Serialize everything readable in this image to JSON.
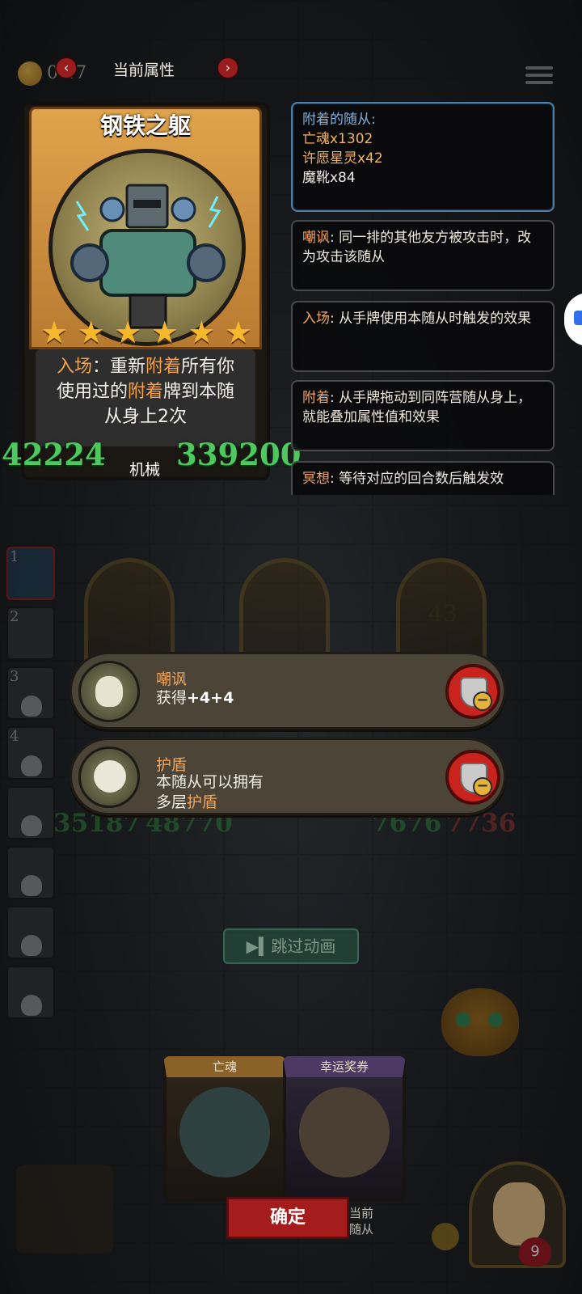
{
  "top_bar": {
    "coin_count": "0 17",
    "title": "当前属性",
    "prev_icon": "chevron-left-icon",
    "next_icon": "chevron-right-icon"
  },
  "hero_card": {
    "name": "钢铁之躯",
    "stars": 6,
    "desc_prefix": "入场",
    "desc_line1_a": "：重新",
    "desc_kw1": "附着",
    "desc_line1_b": "所有你",
    "desc_line2_a": "使用过的",
    "desc_kw2": "附着",
    "desc_line2_b": "牌到本随",
    "desc_line3": "从身上2次",
    "attack": "42224",
    "type": "机械",
    "health": "339200"
  },
  "info_panels": {
    "attached": {
      "title": "附着的随从:",
      "lines": [
        "亡魂x1302",
        "许愿星灵x42",
        "魔靴x84"
      ]
    },
    "taunt": {
      "keyword": "嘲讽",
      "text": ": 同一排的其他友方被攻击时，改为攻击该随从"
    },
    "entry": {
      "keyword": "入场",
      "text": ": 从手牌使用本随从时触发的效果"
    },
    "attach": {
      "keyword": "附着",
      "text": ": 从手牌拖动到同阵营随从身上，就能叠加属性值和效果"
    },
    "meditate": {
      "keyword": "冥想",
      "text": ": 等待对应的回合数后触发效"
    }
  },
  "board": {
    "hand_slots": [
      "1",
      "2",
      "3",
      "4",
      "",
      "",
      "",
      ""
    ],
    "ally_badge": "43",
    "left_stat": "35187",
    "left_stat_2": "48770",
    "right_stat": "7676",
    "right_stat_2": "7736"
  },
  "keyword_popups": {
    "taunt": {
      "title": "嘲讽",
      "text_a": "获得",
      "text_b": "+4+4"
    },
    "shield": {
      "title": "护盾",
      "line1": "本随从可以拥有",
      "line2_a": "多层",
      "line2_kw": "护盾"
    }
  },
  "skip_button": "跳过动画",
  "rewards": [
    {
      "name": "亡魂"
    },
    {
      "name": "幸运奖券"
    }
  ],
  "confirm_button": "确定",
  "current_tag_line1": "当前",
  "current_tag_line2": "随从",
  "player_hp": "9",
  "colors": {
    "keyword": "#f2a55b",
    "stat_green": "#4fc860",
    "confirm_red": "#a41c1c",
    "attach_blue": "#7fb1e0"
  }
}
